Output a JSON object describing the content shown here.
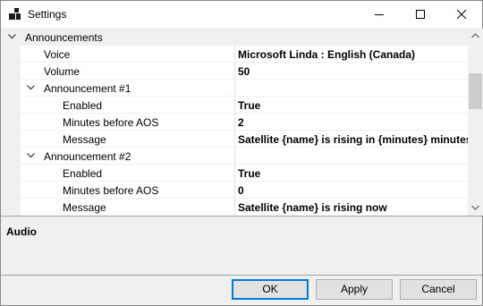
{
  "window": {
    "title": "Settings"
  },
  "grid": {
    "rows": [
      {
        "label": "Announcements",
        "value": "",
        "category": true
      },
      {
        "label": "Voice",
        "value": "Microsoft Linda : English (Canada)"
      },
      {
        "label": "Volume",
        "value": "50"
      },
      {
        "label": "Announcement #1",
        "value": "",
        "category": true
      },
      {
        "label": "Enabled",
        "value": "True"
      },
      {
        "label": "Minutes before AOS",
        "value": "2"
      },
      {
        "label": "Message",
        "value": "Satellite {name} is rising in {minutes} minutes"
      },
      {
        "label": "Announcement #2",
        "value": "",
        "category": true
      },
      {
        "label": "Enabled",
        "value": "True"
      },
      {
        "label": "Minutes before AOS",
        "value": "0"
      },
      {
        "label": "Message",
        "value": "Satellite {name} is rising now"
      }
    ]
  },
  "help": {
    "title": "Audio"
  },
  "buttons": {
    "ok": "OK",
    "apply": "Apply",
    "cancel": "Cancel"
  },
  "colors": {
    "accent": "#0078d7",
    "button_face": "#e1e1e1",
    "category_bg": "#f0f0f0"
  }
}
